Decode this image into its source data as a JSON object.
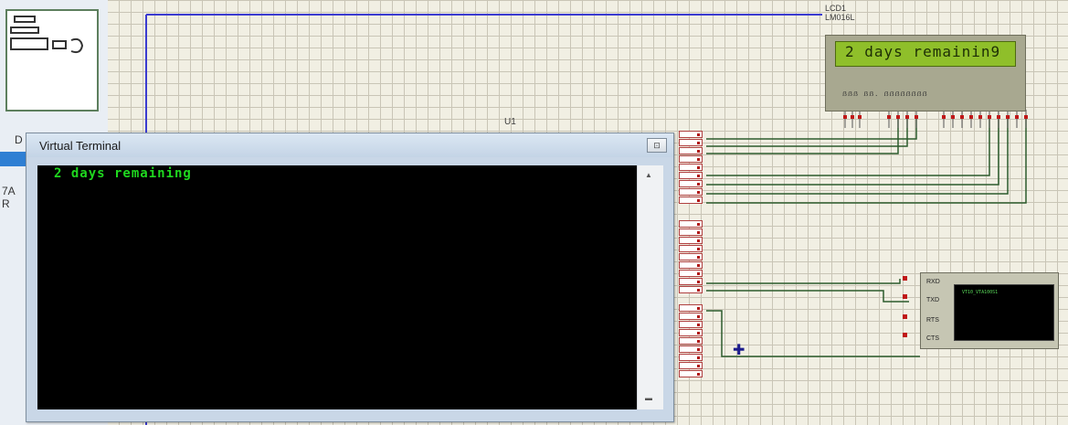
{
  "window": {
    "title": "Virtual Terminal",
    "close_glyph": "⊡",
    "output_text": "2 days remaining"
  },
  "lcd": {
    "ref_label": "LCD1",
    "part_label": "LM016L",
    "display_text": "2 days remainin9"
  },
  "chip": {
    "ref_label": "U1"
  },
  "left_panel": {
    "text_d": "D",
    "text_7a": "7A",
    "text_r": "R"
  },
  "terminal_device": {
    "pins": [
      "RXD",
      "TXD",
      "RTS",
      "CTS"
    ],
    "screen_text": "VT10_VTA100S1"
  },
  "colors": {
    "terminal_text": "#1fd81f",
    "lcd_background": "#8fbf2a",
    "wire": "#2c5c2c",
    "schematic_background": "#f1efe3"
  },
  "scrollbar": {
    "up_glyph": "▲",
    "down_glyph": "▬"
  }
}
